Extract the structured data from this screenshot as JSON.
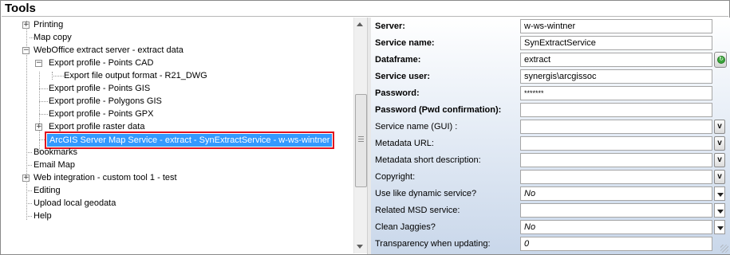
{
  "window": {
    "title": "Tools"
  },
  "tree": {
    "items": [
      {
        "label": "Printing",
        "expander": "+"
      },
      {
        "label": "Map copy"
      },
      {
        "label": "WebOffice extract server - extract data",
        "expander": "−"
      },
      {
        "label": "Export profile - Points CAD",
        "expander": "−"
      },
      {
        "label": "Export file output format - R21_DWG"
      },
      {
        "label": "Export profile - Points GIS"
      },
      {
        "label": "Export profile - Polygons GIS"
      },
      {
        "label": "Export profile - Points GPX"
      },
      {
        "label": "Export profile raster data",
        "expander": "+"
      },
      {
        "label": "ArcGIS Server Map Service - extract - SynExtractService - w-ws-wintner"
      },
      {
        "label": "Bookmarks"
      },
      {
        "label": "Email Map"
      },
      {
        "label": "Web integration - custom tool 1 - test",
        "expander": "+"
      },
      {
        "label": "Editing"
      },
      {
        "label": "Upload local geodata"
      },
      {
        "label": "Help"
      }
    ]
  },
  "properties": {
    "rows": [
      {
        "label": "Server:",
        "value": "w-ws-wintner"
      },
      {
        "label": "Service name:",
        "value": "SynExtractService"
      },
      {
        "label": "Dataframe:",
        "value": "extract"
      },
      {
        "label": "Service user:",
        "value": "synergis\\arcgissoc"
      },
      {
        "label": "Password:",
        "value": "*******"
      },
      {
        "label": "Password (Pwd confirmation):",
        "value": ""
      },
      {
        "label": "Service name (GUI) :",
        "value": "",
        "button": "v"
      },
      {
        "label": "Metadata URL:",
        "value": "",
        "button": "v"
      },
      {
        "label": "Metadata short description:",
        "value": "",
        "button": "v"
      },
      {
        "label": "Copyright:",
        "value": "",
        "button": "v"
      },
      {
        "label": "Use like dynamic service?",
        "value": "No"
      },
      {
        "label": "Related MSD service:",
        "value": ""
      },
      {
        "label": "Clean Jaggies?",
        "value": "No"
      },
      {
        "label": "Transparency when updating:",
        "value": "0"
      }
    ]
  },
  "colors": {
    "selection": "#3399ff",
    "selection_outline": "#e0121f",
    "panel_gradient_end": "#c9d7ea"
  }
}
